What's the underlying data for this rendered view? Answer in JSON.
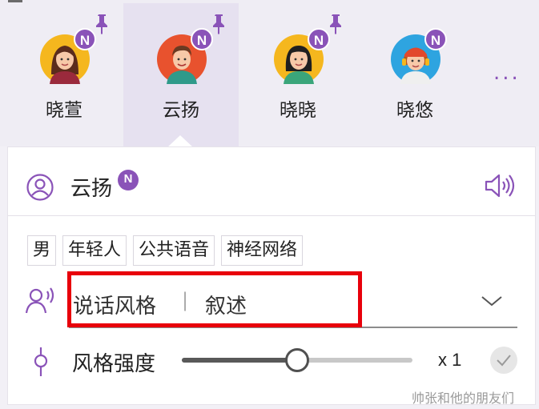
{
  "voices": [
    {
      "name": "晓萱",
      "badge": "N",
      "pinned": true,
      "selected": false
    },
    {
      "name": "云扬",
      "badge": "N",
      "pinned": true,
      "selected": true
    },
    {
      "name": "晓晓",
      "badge": "N",
      "pinned": true,
      "selected": false
    },
    {
      "name": "晓悠",
      "badge": "N",
      "pinned": false,
      "selected": false
    }
  ],
  "more_label": "...",
  "panel": {
    "voice_name": "云扬",
    "voice_badge": "N",
    "tags": [
      "男",
      "年轻人",
      "公共语音",
      "神经网络"
    ],
    "style": {
      "label": "说话风格",
      "separator": "|",
      "value": "叙述"
    },
    "intensity": {
      "label": "风格强度",
      "value_text": "x 1",
      "level_fraction": 0.5
    }
  },
  "watermark": "帅张和他的朋友们",
  "colors": {
    "accent": "#8a53b8",
    "highlight": "#e8000b",
    "selected_bg": "#e6e1f0"
  }
}
